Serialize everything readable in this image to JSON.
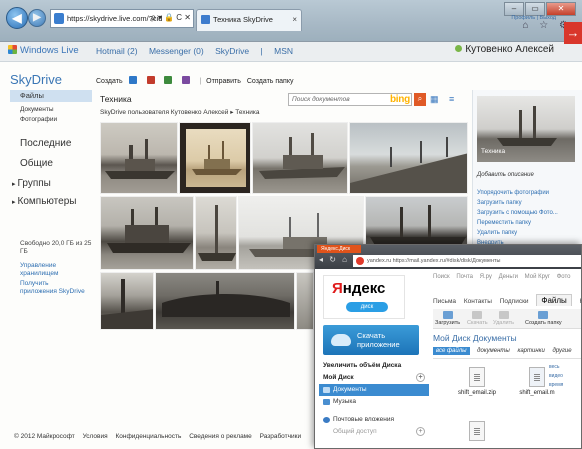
{
  "browser": {
    "address": "https://skydrive.live.com/?cid",
    "address_tools": "ρ ▾ 🔒 C ✕",
    "tab_title": "Техника SkyDrive",
    "tab_close": "×",
    "window_controls": [
      "–",
      "▭",
      "✕"
    ],
    "right_icons": "⌂ ☆ ⚙"
  },
  "wl_header": {
    "logo": "Windows Live",
    "nav": [
      "Hotmail (2)",
      "Messenger (0)",
      "SkyDrive",
      "|",
      "MSN"
    ],
    "user": "Кутовенко Алексей",
    "profile": "Профиль | Выход",
    "red_badge": "→"
  },
  "skydrive": {
    "title": "SkyDrive",
    "commands": [
      "Создать",
      "Отправить",
      "Создать папку"
    ],
    "sidebar": {
      "active": "Файлы",
      "sub": [
        "Документы",
        "Фотографии"
      ],
      "sections": [
        "Последние",
        "Общие",
        "Группы",
        "Компьютеры"
      ],
      "storage": "Свободно 20,0 ГБ из 25 ГБ",
      "links": [
        "Управление хранилищем",
        "Получить приложения SkyDrive"
      ]
    },
    "folder_title": "Техника",
    "breadcrumb": "SkyDrive пользователя Кутовенко Алексей  ▸  Техника",
    "search_placeholder": "Поиск документов",
    "bing": "bing",
    "search_icon": "⌕",
    "view_icons": "▦ ≡",
    "right_pane": {
      "preview_label": "Техника",
      "add_description": "Добавить описание",
      "actions": [
        "Упорядочить фотографии",
        "Загрузить папку",
        "Загрузить с помощью Фото...",
        "Переместить папку",
        "Удалить папку",
        "Внедрить"
      ]
    }
  },
  "footer": [
    "© 2012 Майкрософт",
    "Условия",
    "Конфиденциальность",
    "Сведения о рекламе",
    "Разработчики"
  ],
  "yandex": {
    "tab": "Яндекс.Диск",
    "nav": "◂ ↻ ⌂",
    "url": "yandex.ru   https://mail.yandex.ru/#disk/disk/Документы",
    "services": [
      "Поиск",
      "Почта",
      "Я.ру",
      "Деньги",
      "Мой Круг",
      "Фото"
    ],
    "logo": {
      "ya": "Я",
      "ndex": "ндекс",
      "disk": "диск"
    },
    "download_label": "Скачать приложение",
    "sidebar": {
      "promo": "Увеличить объём Диска",
      "my_disk": "Мой Диск",
      "items": [
        "Документы",
        "Музыка"
      ],
      "extra": "Почтовые вложения",
      "shared": "Общий доступ"
    },
    "tabs": [
      "Письма",
      "Контакты",
      "Подписки",
      "Файлы",
      "Ка"
    ],
    "toolbar": [
      "Загрузить",
      "Скачать",
      "Удалить",
      "Создать папку"
    ],
    "path": "Мой Диск  Документы",
    "filters": [
      "все файлы",
      "документы",
      "картинки",
      "другие"
    ],
    "files": [
      "shift_email.zip",
      "shift_email.m"
    ],
    "preview_links": [
      "весь",
      "видео",
      "время"
    ]
  }
}
